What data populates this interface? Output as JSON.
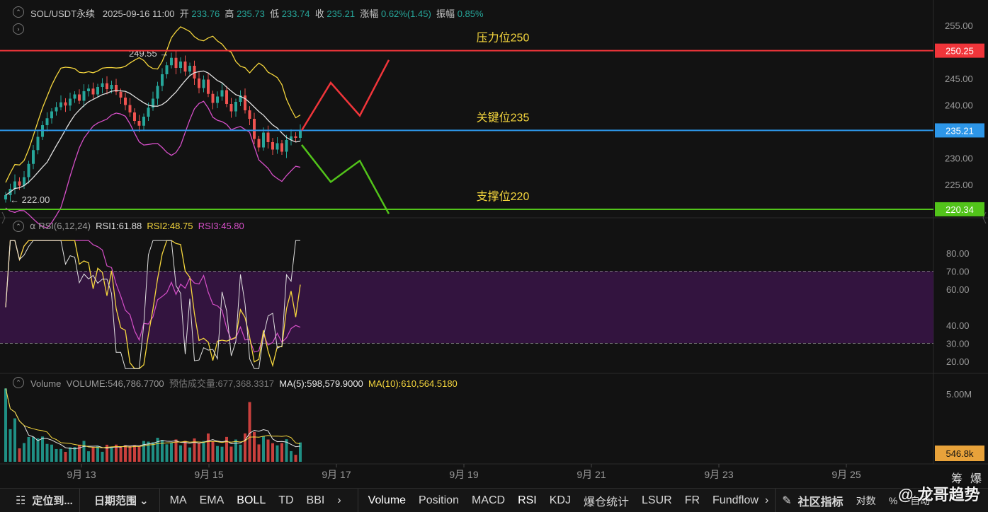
{
  "header": {
    "symbol": "SOL/USDT永续",
    "datetime": "2025-09-16 11:00",
    "open_label": "开",
    "open": "233.76",
    "high_label": "高",
    "high": "235.73",
    "low_label": "低",
    "low": "233.74",
    "close_label": "收",
    "close": "235.21",
    "change_label": "涨幅",
    "change": "0.62%(1.45)",
    "amplitude_label": "振幅",
    "amplitude": "0.85%"
  },
  "chart_data": [
    {
      "type": "candlestick",
      "title": "SOL/USDT永续",
      "indicator": "BOLL",
      "y_ticks": [
        "255.00",
        "250.00",
        "245.00",
        "240.00",
        "235.00",
        "230.00",
        "225.00"
      ],
      "ylim": [
        218.5,
        256.5
      ],
      "x_ticks": [
        "9月 13",
        "9月 15",
        "9月 17",
        "9月 19",
        "9月 21",
        "9月 23",
        "9月 25"
      ],
      "high_marker": {
        "label": "249.55 →",
        "value": 249.55
      },
      "low_marker": {
        "label": "← 222.00",
        "value": 222.0
      },
      "levels": [
        {
          "name": "压力位250",
          "value": 250.25,
          "badge": "250.25",
          "color": "#f0353a"
        },
        {
          "name": "关键位235",
          "value": 235.21,
          "badge": "235.21",
          "color": "#2d96e8"
        },
        {
          "name": "支撑位220",
          "value": 220.34,
          "badge": "220.34",
          "color": "#52c41a"
        }
      ],
      "projection_up": [
        [
          235.21,
          0
        ],
        [
          244.2,
          1
        ],
        [
          238.0,
          2
        ],
        [
          248.5,
          3
        ]
      ],
      "projection_down": [
        [
          232.5,
          0
        ],
        [
          225.5,
          1
        ],
        [
          229.5,
          2
        ],
        [
          219.5,
          3
        ]
      ],
      "close_series": [
        223.0,
        224.2,
        225.6,
        224.8,
        226.4,
        228.9,
        231.5,
        234.0,
        236.2,
        237.5,
        238.8,
        239.6,
        240.5,
        239.9,
        241.2,
        242.0,
        240.8,
        242.6,
        243.1,
        242.0,
        243.4,
        244.1,
        243.0,
        243.8,
        242.5,
        241.4,
        240.0,
        238.6,
        237.0,
        236.1,
        237.8,
        239.5,
        241.2,
        243.6,
        245.8,
        247.5,
        248.9,
        247.0,
        248.2,
        246.3,
        247.4,
        245.0,
        243.2,
        244.8,
        242.1,
        240.4,
        241.6,
        242.8,
        240.2,
        238.8,
        240.6,
        241.8,
        239.0,
        237.4,
        233.6,
        232.0,
        234.8,
        233.0,
        231.6,
        232.8,
        231.2,
        233.4,
        234.1,
        233.8,
        235.21
      ]
    },
    {
      "type": "line",
      "title": "RSI(6,12,24)",
      "series": [
        {
          "name": "RSI1:61.88",
          "color": "#e0e0e0"
        },
        {
          "name": "RSI2:48.75",
          "color": "#f5d63d"
        },
        {
          "name": "RSI3:45.80",
          "color": "#d64fc8"
        }
      ],
      "y_ticks": [
        "80.00",
        "70.00",
        "60.00",
        "40.00",
        "30.00",
        "20.00"
      ],
      "ylim": [
        15,
        88
      ],
      "band": [
        30,
        70
      ]
    },
    {
      "type": "bar",
      "title": "Volume",
      "values_label": "VOLUME:546,786.7700",
      "estimate_label": "预估成交量:677,368.3317",
      "ma5": "MA(5):598,579.9000",
      "ma10": "MA(10):610,564.5180",
      "y_ticks": [
        "5.00M"
      ],
      "current_badge": "546.8k"
    }
  ],
  "bottom_bar": {
    "locate": "定位到...",
    "date_range": "日期范围",
    "main_indicators": [
      "MA",
      "EMA",
      "BOLL",
      "TD",
      "BBI"
    ],
    "sub_indicators": [
      "Volume",
      "Position",
      "MACD",
      "RSI",
      "KDJ",
      "爆仓统计",
      "LSUR",
      "FR",
      "Fundflow"
    ],
    "community": "社区指标",
    "right": [
      "对数",
      "%",
      "自动"
    ]
  },
  "side_labels": {
    "a": "筹",
    "b": "爆"
  },
  "watermark": "@ 龙哥趋势"
}
